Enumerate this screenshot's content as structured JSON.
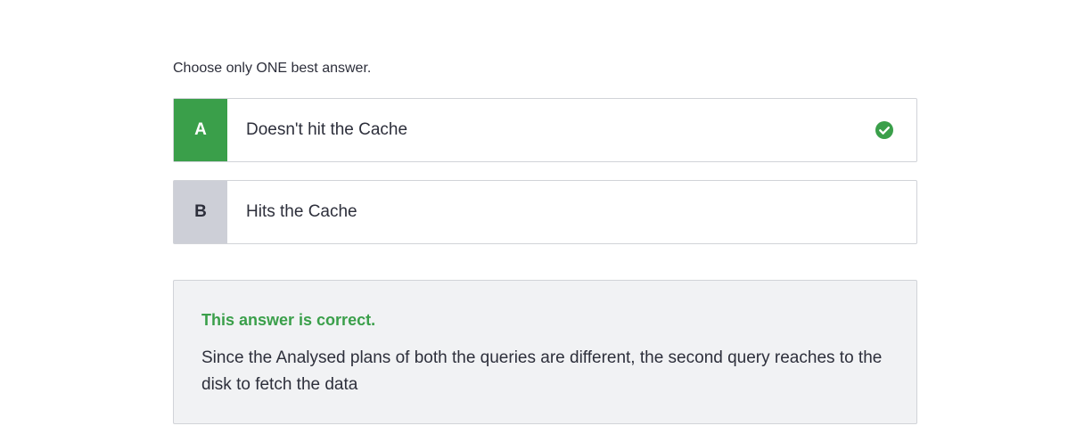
{
  "instruction": "Choose only ONE best answer.",
  "options": [
    {
      "letter": "A",
      "text": "Doesn't hit the Cache",
      "selected_correct": true,
      "icon": "check-circle-icon"
    },
    {
      "letter": "B",
      "text": "Hits the Cache",
      "selected_correct": false
    }
  ],
  "feedback": {
    "title": "This answer is correct.",
    "explanation": "Since the Analysed plans of both the queries are different, the second query reaches to the disk to fetch the data"
  },
  "colors": {
    "correct_green": "#3a9f4a",
    "neutral_letter_bg": "#cdcfd7",
    "feedback_bg": "#f1f2f4",
    "border": "#d1d3d8",
    "text": "#2d2f3b"
  }
}
